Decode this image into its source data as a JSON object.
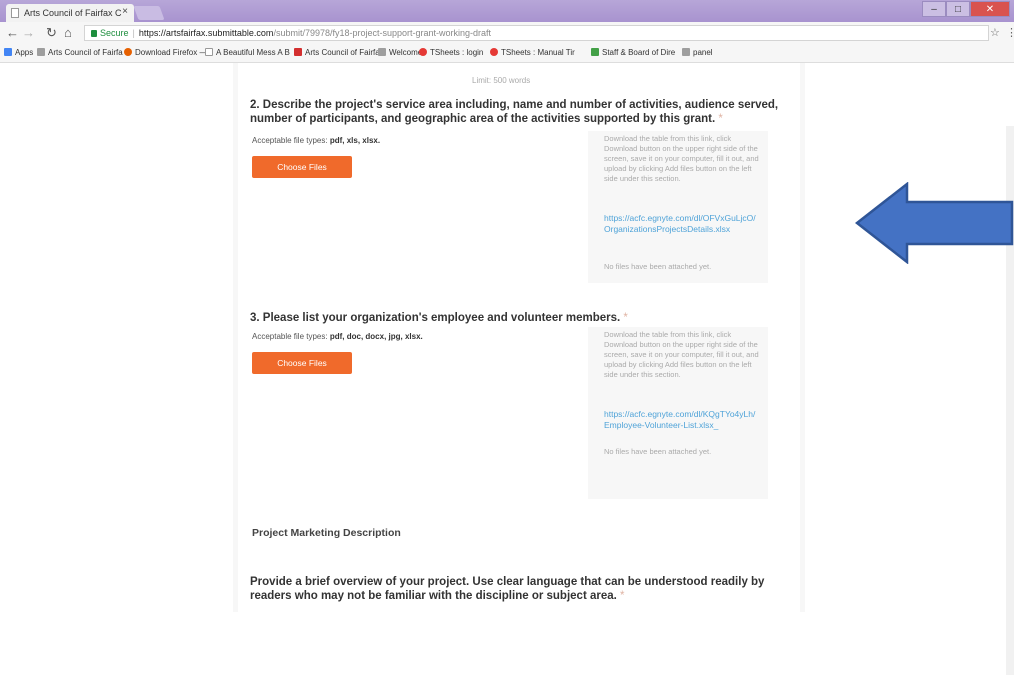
{
  "browser": {
    "tab_title": "Arts Council of Fairfax C",
    "tab_close": "×",
    "url_secure_label": "Secure",
    "url_host": "https://artsfairfax.submittable.com",
    "url_path": "/submit/79978/fy18-project-support-grant-working-draft",
    "bookmarks": [
      {
        "label": "Apps",
        "color": "#4285f4"
      },
      {
        "label": "Arts Council of Fairfa",
        "color": "#9e9e9e"
      },
      {
        "label": "Download Firefox —",
        "color": "#e66000"
      },
      {
        "label": "A Beautiful Mess A B",
        "color": "#bdbdbd"
      },
      {
        "label": "Arts Council of Fairfa",
        "color": "#d32f2f"
      },
      {
        "label": "Welcome",
        "color": "#9e9e9e"
      },
      {
        "label": "TSheets : login",
        "color": "#e53935"
      },
      {
        "label": "TSheets : Manual Tir",
        "color": "#e53935"
      },
      {
        "label": "Staff & Board of Dire",
        "color": "#43a047"
      },
      {
        "label": "panel",
        "color": "#9e9e9e"
      }
    ]
  },
  "form": {
    "limit_text": "Limit: 500 words",
    "q2": {
      "title": "2. Describe the project's service area including, name and number of activities, audience served, number of participants, and geographic area of the activities supported by this grant.",
      "required_mark": "*",
      "file_types_label": "Acceptable file types:",
      "file_types": "pdf, xls, xlsx.",
      "button_label": "Choose Files",
      "help_text": "Download the table from this link, click Download button on the upper right side of the screen, save it on your computer, fill it out, and upload by clicking Add files button on the left side under this section.",
      "link_text": "https://acfc.egnyte.com/dl/OFVxGuLjcO/OrganizationsProjectsDetails.xlsx",
      "no_files_text": "No files have been attached yet."
    },
    "q3": {
      "title": "3. Please list your organization's employee and volunteer members.",
      "required_mark": "*",
      "file_types_label": "Acceptable file types:",
      "file_types": "pdf, doc, docx, jpg, xlsx.",
      "button_label": "Choose Files",
      "help_text": "Download the table from this link, click Download button on the upper right side of the screen, save it on your computer, fill it out, and upload by clicking Add files button on the left side under this section.",
      "link_text": "https://acfc.egnyte.com/dl/KQgTYo4yLh/Employee-Volunteer-List.xlsx_",
      "no_files_text": "No files have been attached yet."
    },
    "section_title": "Project Marketing Description",
    "q4": {
      "title": "Provide a brief overview of your project. Use clear language that can be understood readily by readers who may not be familiar with the discipline or subject area.",
      "required_mark": "*"
    }
  },
  "annotation": {
    "arrow_color": "#4472c4",
    "arrow_border": "#2f5597",
    "arrow_icon": "left-arrow-icon"
  }
}
